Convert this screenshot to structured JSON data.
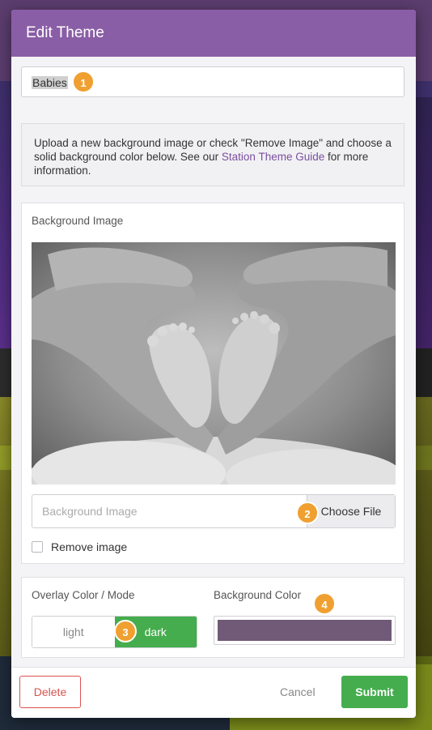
{
  "modal": {
    "title": "Edit Theme"
  },
  "theme_name": {
    "value": "Babies",
    "badge": "1"
  },
  "info": {
    "text_before": "Upload a new background image or check \"Remove Image\" and choose a solid background color below. See our ",
    "link_text": "Station Theme Guide",
    "text_after": " for more information."
  },
  "background_image": {
    "label": "Background Image",
    "file_placeholder": "Background Image",
    "choose_file_label": "Choose File",
    "badge": "2",
    "remove_label": "Remove image",
    "remove_checked": false
  },
  "overlay": {
    "label": "Overlay Color / Mode",
    "options": [
      "light",
      "dark"
    ],
    "selected": "dark",
    "badge": "3"
  },
  "background_color": {
    "label": "Background Color",
    "value": "#705a78",
    "badge": "4"
  },
  "footer": {
    "delete_label": "Delete",
    "cancel_label": "Cancel",
    "submit_label": "Submit"
  },
  "colors": {
    "header": "#8a5ea6",
    "accent_green": "#45ad4d",
    "badge_orange": "#f0a030",
    "delete_red": "#d9534f",
    "link_purple": "#7b4fa0"
  }
}
